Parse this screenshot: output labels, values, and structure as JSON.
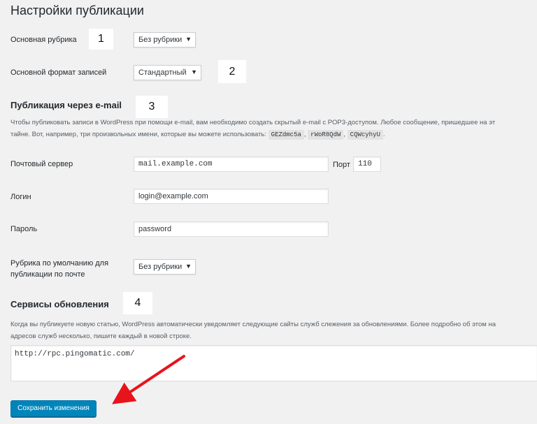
{
  "page": {
    "title": "Настройки публикации"
  },
  "default_category": {
    "label": "Основная рубрика",
    "value": "Без рубрики"
  },
  "default_format": {
    "label": "Основной формат записей",
    "value": "Стандартный"
  },
  "post_via_email": {
    "heading": "Публикация через e-mail",
    "description_line1": "Чтобы публиковать записи в WordPress при помощи e-mail, вам необходимо создать скрытый e-mail с POP3-доступом. Любое сообщение, пришедшее на эт",
    "description_line2": "тайне. Вот, например, три произвольных имени, которые вы можете использовать:",
    "random_names": [
      "GEZdmc5a",
      "rWoR8QdW",
      "CQWcyhyU"
    ],
    "separator": ",",
    "end_punct": "."
  },
  "mail_server": {
    "label": "Почтовый сервер",
    "value": "mail.example.com",
    "port_label": "Порт",
    "port_value": "110"
  },
  "login": {
    "label": "Логин",
    "value": "login@example.com"
  },
  "password": {
    "label": "Пароль",
    "value": "password"
  },
  "mail_category": {
    "label_line1": "Рубрика по умолчанию для",
    "label_line2": "публикации по почте",
    "value": "Без рубрики"
  },
  "update_services": {
    "heading": "Сервисы обновления",
    "description_line1": "Когда вы публикуете новую статью, WordPress автоматически уведомляет следующие сайты служб слежения за обновлениями. Более подробно об этом на",
    "description_line2": "адресов служб несколько, пишите каждый в новой строке.",
    "textarea_value": "http://rpc.pingomatic.com/"
  },
  "save_button": {
    "label": "Сохранить изменения"
  },
  "annotations": {
    "n1": "1",
    "n2": "2",
    "n3": "3",
    "n4": "4"
  },
  "colors": {
    "arrow": "#e8141c",
    "button": "#0085ba",
    "background": "#f1f1f1"
  },
  "icons": {
    "dropdown": "triangle-down-icon",
    "annotation": "red-arrow-icon"
  }
}
